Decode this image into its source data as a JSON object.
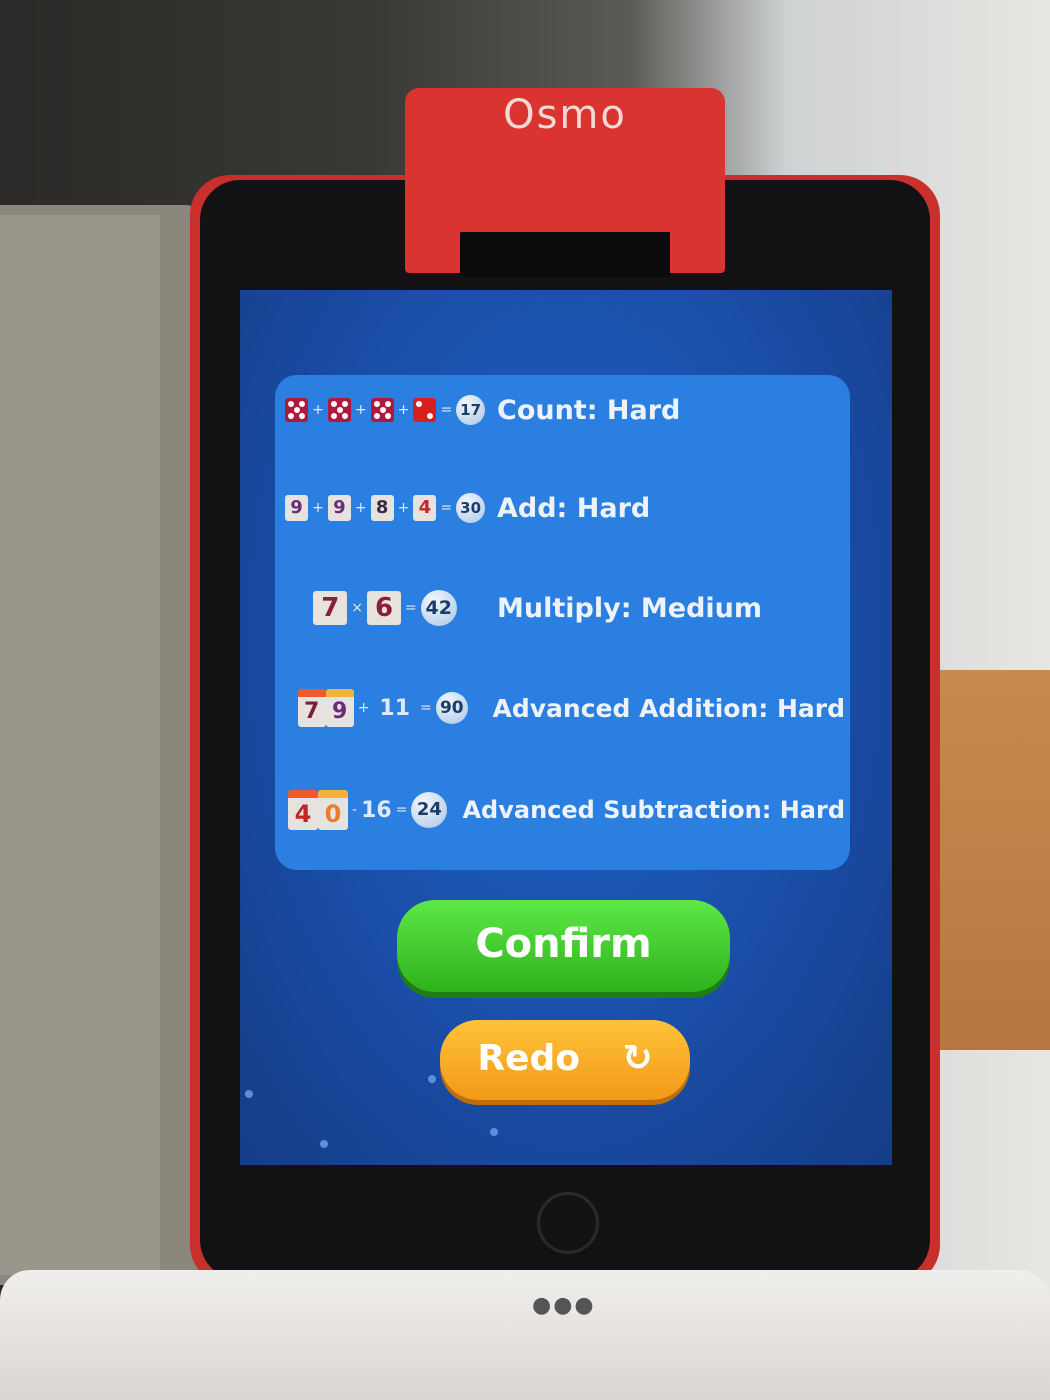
{
  "device": {
    "brand_logo": "Osmo"
  },
  "levels": [
    {
      "label": "Count: Hard",
      "equation": {
        "type": "dice",
        "dice": [
          5,
          5,
          5,
          2
        ],
        "operator": "+",
        "result": "17"
      }
    },
    {
      "label": "Add: Hard",
      "equation": {
        "type": "tiles",
        "tiles": [
          "9",
          "9",
          "8",
          "4"
        ],
        "operator": "+",
        "result": "30"
      }
    },
    {
      "label": "Multiply: Medium",
      "equation": {
        "type": "tiles",
        "tiles": [
          "7",
          "6"
        ],
        "operator": "×",
        "result": "42"
      }
    },
    {
      "label": "Advanced Addition: Hard",
      "equation": {
        "type": "place-value",
        "tiles": [
          "7",
          "9"
        ],
        "operator": "+",
        "operand": "11",
        "result": "90"
      }
    },
    {
      "label": "Advanced Subtraction: Hard",
      "equation": {
        "type": "place-value",
        "tiles": [
          "4",
          "0"
        ],
        "operator": "-",
        "operand": "16",
        "result": "24"
      }
    }
  ],
  "buttons": {
    "confirm": "Confirm",
    "redo": "Redo",
    "redo_icon": "redo-arrow-icon"
  },
  "colors": {
    "confirm": "#3ccc2a",
    "redo": "#f7a823",
    "panel": "#2b7fe0",
    "screen": "#1a4ea8"
  }
}
